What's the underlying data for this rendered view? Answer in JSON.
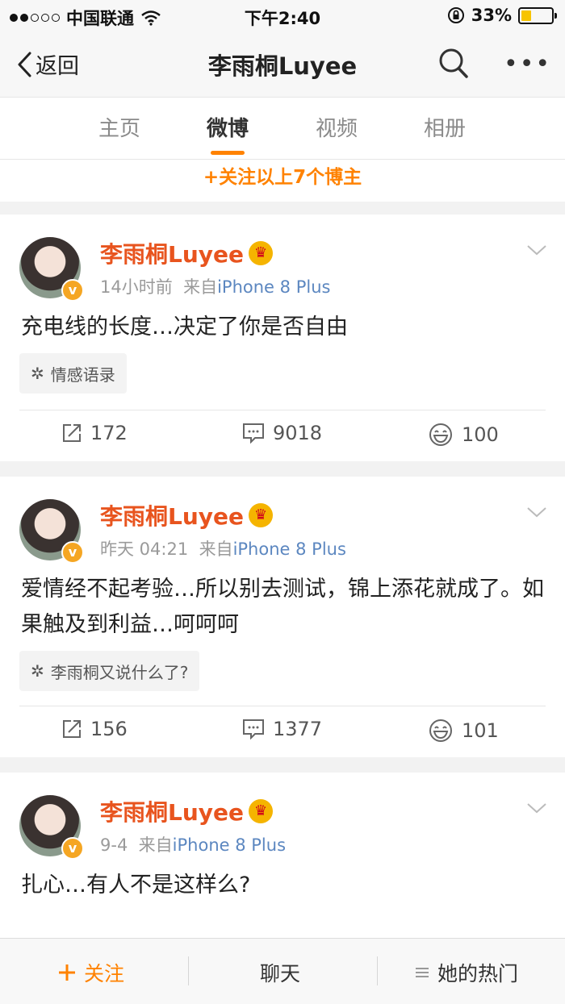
{
  "status_bar": {
    "carrier": "中国联通",
    "time": "下午2:40",
    "battery": "33%",
    "battery_level": 0.33
  },
  "nav": {
    "back_label": "返回",
    "title": "李雨桐Luyee"
  },
  "tabs": [
    {
      "label": "主页"
    },
    {
      "label": "微博"
    },
    {
      "label": "视频"
    },
    {
      "label": "相册"
    }
  ],
  "follow_more": "+关注以上7个博主",
  "posts": [
    {
      "author": "李雨桐Luyee",
      "time": "14小时前",
      "source_prefix": "来自",
      "source": "iPhone 8 Plus",
      "content": "充电线的长度…决定了你是否自由",
      "topic": "情感语录",
      "reposts": "172",
      "comments": "9018",
      "likes": "100"
    },
    {
      "author": "李雨桐Luyee",
      "time": "昨天 04:21",
      "source_prefix": "来自",
      "source": "iPhone 8 Plus",
      "content": "爱情经不起考验…所以别去测试，锦上添花就成了。如果触及到利益…呵呵呵",
      "topic": "李雨桐又说什么了?",
      "reposts": "156",
      "comments": "1377",
      "likes": "101"
    },
    {
      "author": "李雨桐Luyee",
      "time": "9-4",
      "source_prefix": "来自",
      "source": "iPhone 8 Plus",
      "content": "扎心…有人不是这样么?"
    }
  ],
  "bottom_bar": {
    "follow": "关注",
    "chat": "聊天",
    "hot": "她的热门"
  },
  "colors": {
    "accent": "#ff8200",
    "author": "#e8541e",
    "source_link": "#5c87c0"
  }
}
